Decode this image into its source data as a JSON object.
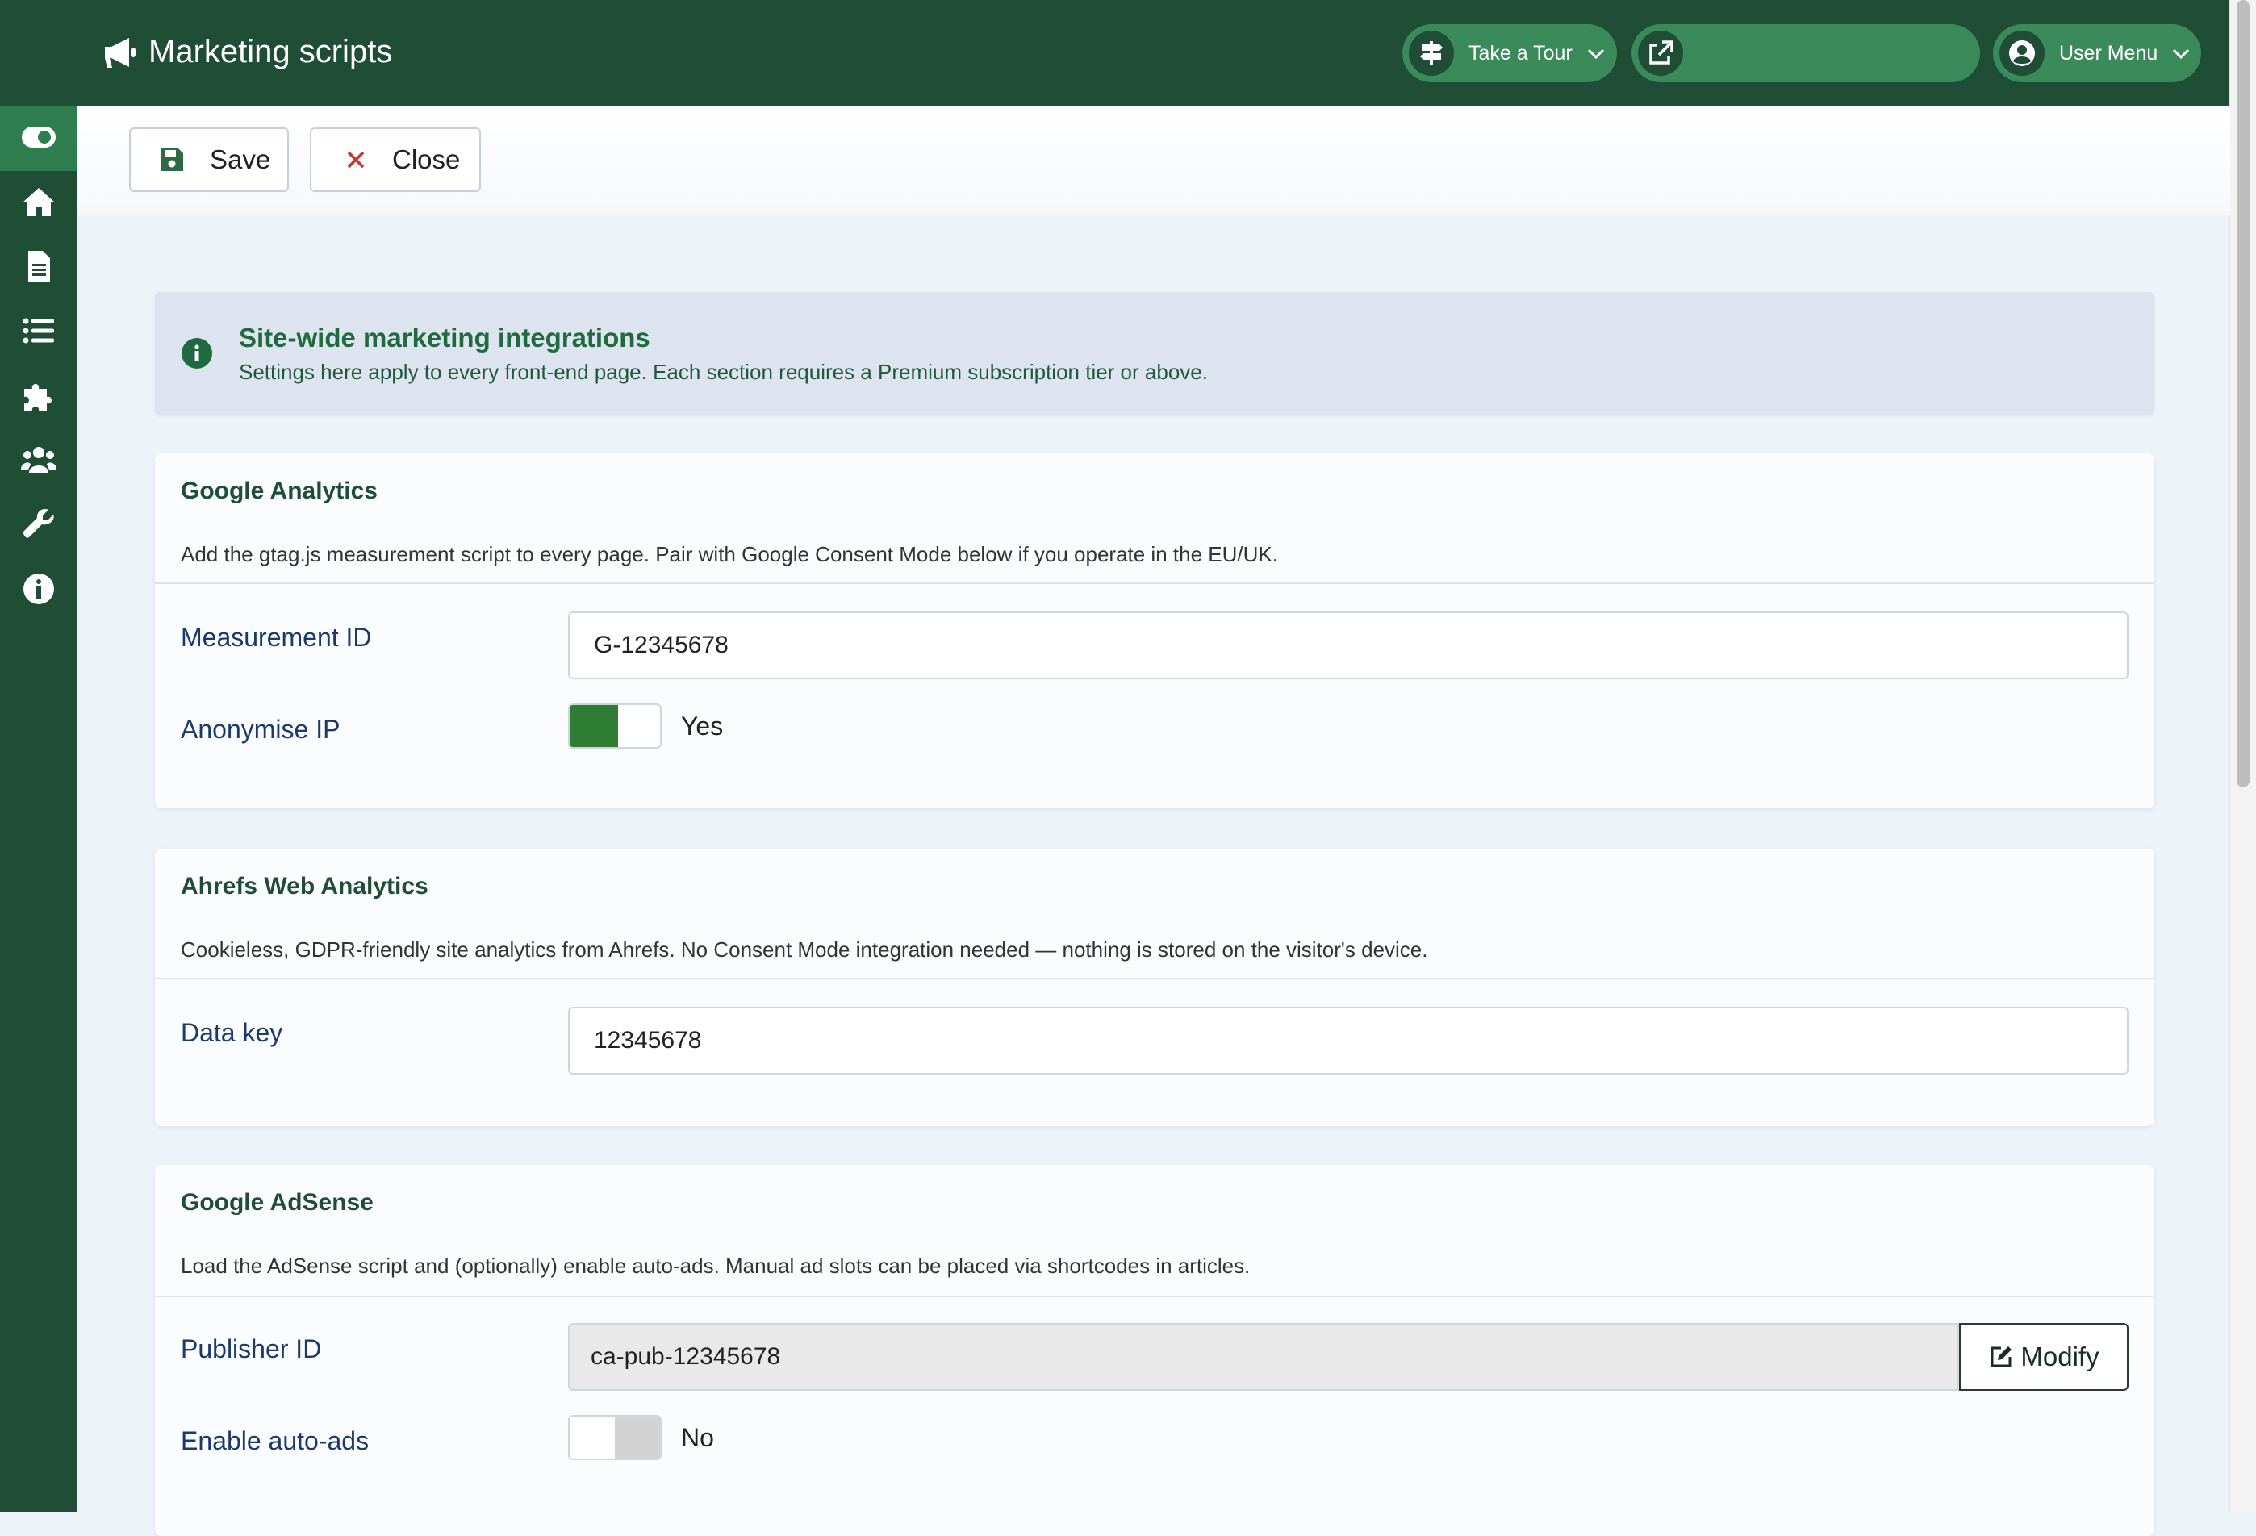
{
  "header": {
    "title": "Marketing scripts",
    "tour_label": "Take a Tour",
    "site_link_label": "",
    "user_menu_label": "User Menu"
  },
  "sidebar": {
    "items": [
      {
        "name": "toggle-menu",
        "icon": "toggle-icon",
        "active": true
      },
      {
        "name": "home",
        "icon": "home-icon"
      },
      {
        "name": "content",
        "icon": "document-icon"
      },
      {
        "name": "menus",
        "icon": "list-icon"
      },
      {
        "name": "components",
        "icon": "puzzle-icon"
      },
      {
        "name": "users",
        "icon": "users-icon"
      },
      {
        "name": "system",
        "icon": "wrench-icon"
      },
      {
        "name": "help",
        "icon": "info-icon"
      }
    ]
  },
  "toolbar": {
    "save_label": "Save",
    "close_label": "Close"
  },
  "alert": {
    "title": "Site-wide marketing integrations",
    "text": "Settings here apply to every front-end page. Each section requires a Premium subscription tier or above."
  },
  "google_analytics": {
    "title": "Google Analytics",
    "description": "Add the gtag.js measurement script to every page. Pair with Google Consent Mode below if you operate in the EU/UK.",
    "measurement_id_label": "Measurement ID",
    "measurement_id_value": "G-12345678",
    "anonymise_label": "Anonymise IP",
    "anonymise_value": "Yes",
    "anonymise_on": true
  },
  "ahrefs": {
    "title": "Ahrefs Web Analytics",
    "description": "Cookieless, GDPR-friendly site analytics from Ahrefs. No Consent Mode integration needed — nothing is stored on the visitor's device.",
    "data_key_label": "Data key",
    "data_key_value": "12345678"
  },
  "adsense": {
    "title": "Google AdSense",
    "description": "Load the AdSense script and (optionally) enable auto-ads. Manual ad slots can be placed via shortcodes in articles.",
    "publisher_id_label": "Publisher ID",
    "publisher_id_value": "ca-pub-12345678",
    "modify_label": "Modify",
    "auto_ads_label": "Enable auto-ads",
    "auto_ads_value": "No",
    "auto_ads_on": false
  },
  "colors": {
    "brand_dark": "#1f4d36",
    "brand_button": "#3a8a5a",
    "toggle_on": "#2e7d32",
    "close_x": "#d32f2f"
  }
}
